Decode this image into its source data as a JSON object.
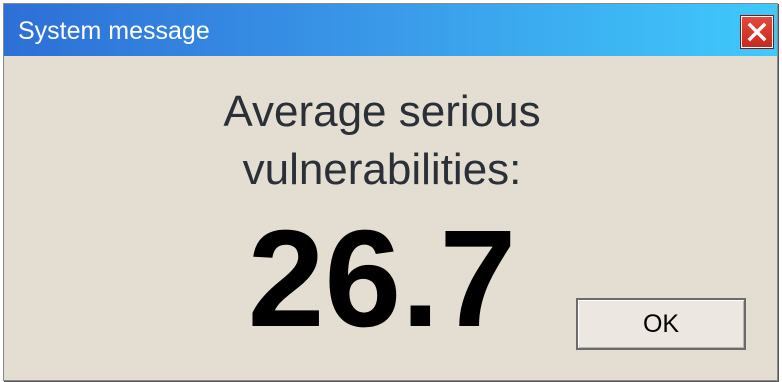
{
  "window": {
    "title": "System message",
    "close_icon": "close-icon"
  },
  "message": {
    "line1": "Average serious",
    "line2": "vulnerabilities:",
    "value": "26.7"
  },
  "buttons": {
    "ok_label": "OK"
  },
  "colors": {
    "titlebar_start": "#2d6fd6",
    "titlebar_end": "#3fc9fb",
    "dialog_bg": "#e3ddd2",
    "close_button": "#d23a2b"
  }
}
